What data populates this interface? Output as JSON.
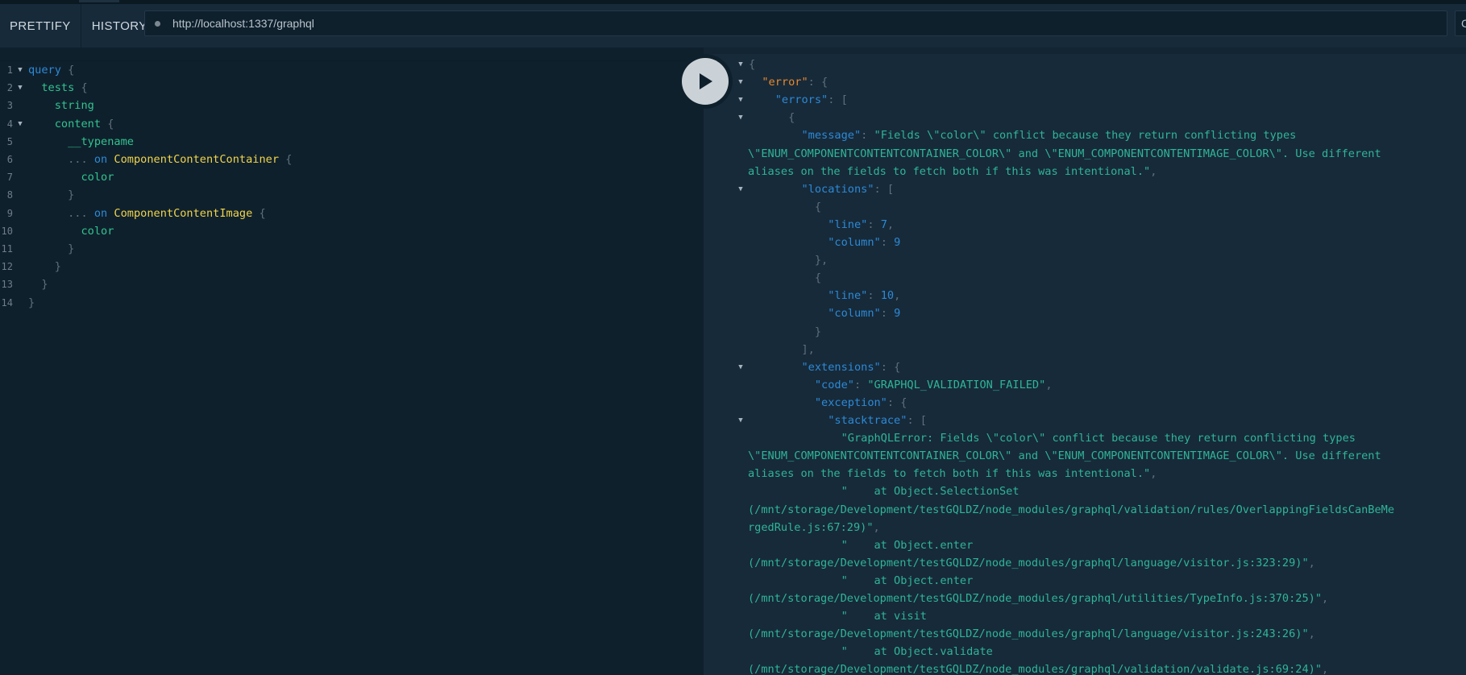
{
  "toolbar": {
    "prettify_label": "PRETTIFY",
    "history_label": "HISTORY",
    "url": "http://localhost:1337/graphql",
    "edge_label": "C"
  },
  "editor": {
    "line_numbers": [
      "1",
      "2",
      "3",
      "4",
      "5",
      "6",
      "7",
      "8",
      "9",
      "10",
      "11",
      "12",
      "13",
      "14"
    ],
    "lines": [
      [
        {
          "t": "query",
          "c": "kw"
        },
        {
          "t": " {",
          "c": "punc"
        }
      ],
      [
        {
          "t": "  tests",
          "c": "field"
        },
        {
          "t": " {",
          "c": "punc"
        }
      ],
      [
        {
          "t": "    string",
          "c": "field"
        }
      ],
      [
        {
          "t": "    content",
          "c": "field"
        },
        {
          "t": " {",
          "c": "punc"
        }
      ],
      [
        {
          "t": "      __typename",
          "c": "field"
        }
      ],
      [
        {
          "t": "      ... ",
          "c": "punc"
        },
        {
          "t": "on",
          "c": "kw"
        },
        {
          "t": " ",
          "c": "punc"
        },
        {
          "t": "ComponentContentContainer",
          "c": "type"
        },
        {
          "t": " {",
          "c": "punc"
        }
      ],
      [
        {
          "t": "        color",
          "c": "field"
        }
      ],
      [
        {
          "t": "      }",
          "c": "punc"
        }
      ],
      [
        {
          "t": "      ... ",
          "c": "punc"
        },
        {
          "t": "on",
          "c": "kw"
        },
        {
          "t": " ",
          "c": "punc"
        },
        {
          "t": "ComponentContentImage",
          "c": "type"
        },
        {
          "t": " {",
          "c": "punc"
        }
      ],
      [
        {
          "t": "        color",
          "c": "field"
        }
      ],
      [
        {
          "t": "      }",
          "c": "punc"
        }
      ],
      [
        {
          "t": "    }",
          "c": "punc"
        }
      ],
      [
        {
          "t": "  }",
          "c": "punc"
        }
      ],
      [
        {
          "t": "}",
          "c": "punc"
        }
      ]
    ]
  },
  "result": {
    "lines": [
      [
        {
          "t": "{",
          "c": "punc"
        }
      ],
      [
        {
          "t": "  ",
          "c": "punc"
        },
        {
          "t": "\"error\"",
          "c": "err"
        },
        {
          "t": ": {",
          "c": "punc"
        }
      ],
      [
        {
          "t": "    ",
          "c": "punc"
        },
        {
          "t": "\"errors\"",
          "c": "key"
        },
        {
          "t": ": [",
          "c": "punc"
        }
      ],
      [
        {
          "t": "      {",
          "c": "punc"
        }
      ],
      [
        {
          "t": "        ",
          "c": "punc"
        },
        {
          "t": "\"message\"",
          "c": "key"
        },
        {
          "t": ": ",
          "c": "punc"
        },
        {
          "t": "\"Fields \\\"color\\\" conflict because they return conflicting types",
          "c": "str"
        }
      ],
      [
        {
          "t": "\\\"ENUM_COMPONENTCONTENTCONTAINER_COLOR\\\" and \\\"ENUM_COMPONENTCONTENTIMAGE_COLOR\\\". Use different",
          "c": "str",
          "wrap": true
        }
      ],
      [
        {
          "t": "aliases on the fields to fetch both if this was intentional.\"",
          "c": "str",
          "wrap": true
        },
        {
          "t": ",",
          "c": "punc"
        }
      ],
      [
        {
          "t": "        ",
          "c": "punc"
        },
        {
          "t": "\"locations\"",
          "c": "key"
        },
        {
          "t": ": [",
          "c": "punc"
        }
      ],
      [
        {
          "t": "          {",
          "c": "punc"
        }
      ],
      [
        {
          "t": "            ",
          "c": "punc"
        },
        {
          "t": "\"line\"",
          "c": "key"
        },
        {
          "t": ": ",
          "c": "punc"
        },
        {
          "t": "7",
          "c": "num"
        },
        {
          "t": ",",
          "c": "punc"
        }
      ],
      [
        {
          "t": "            ",
          "c": "punc"
        },
        {
          "t": "\"column\"",
          "c": "key"
        },
        {
          "t": ": ",
          "c": "punc"
        },
        {
          "t": "9",
          "c": "num"
        }
      ],
      [
        {
          "t": "          },",
          "c": "punc"
        }
      ],
      [
        {
          "t": "          {",
          "c": "punc"
        }
      ],
      [
        {
          "t": "            ",
          "c": "punc"
        },
        {
          "t": "\"line\"",
          "c": "key"
        },
        {
          "t": ": ",
          "c": "punc"
        },
        {
          "t": "10",
          "c": "num"
        },
        {
          "t": ",",
          "c": "punc"
        }
      ],
      [
        {
          "t": "            ",
          "c": "punc"
        },
        {
          "t": "\"column\"",
          "c": "key"
        },
        {
          "t": ": ",
          "c": "punc"
        },
        {
          "t": "9",
          "c": "num"
        }
      ],
      [
        {
          "t": "          }",
          "c": "punc"
        }
      ],
      [
        {
          "t": "        ],",
          "c": "punc"
        }
      ],
      [
        {
          "t": "        ",
          "c": "punc"
        },
        {
          "t": "\"extensions\"",
          "c": "key"
        },
        {
          "t": ": {",
          "c": "punc"
        }
      ],
      [
        {
          "t": "          ",
          "c": "punc"
        },
        {
          "t": "\"code\"",
          "c": "key"
        },
        {
          "t": ": ",
          "c": "punc"
        },
        {
          "t": "\"GRAPHQL_VALIDATION_FAILED\"",
          "c": "str"
        },
        {
          "t": ",",
          "c": "punc"
        }
      ],
      [
        {
          "t": "          ",
          "c": "punc"
        },
        {
          "t": "\"exception\"",
          "c": "key"
        },
        {
          "t": ": {",
          "c": "punc"
        }
      ],
      [
        {
          "t": "            ",
          "c": "punc"
        },
        {
          "t": "\"stacktrace\"",
          "c": "key"
        },
        {
          "t": ": [",
          "c": "punc"
        }
      ],
      [
        {
          "t": "              ",
          "c": "punc"
        },
        {
          "t": "\"GraphQLError: Fields \\\"color\\\" conflict because they return conflicting types",
          "c": "str"
        }
      ],
      [
        {
          "t": "\\\"ENUM_COMPONENTCONTENTCONTAINER_COLOR\\\" and \\\"ENUM_COMPONENTCONTENTIMAGE_COLOR\\\". Use different",
          "c": "str",
          "wrap": true
        }
      ],
      [
        {
          "t": "aliases on the fields to fetch both if this was intentional.\"",
          "c": "str",
          "wrap": true
        },
        {
          "t": ",",
          "c": "punc"
        }
      ],
      [
        {
          "t": "              ",
          "c": "punc"
        },
        {
          "t": "\"    at Object.SelectionSet",
          "c": "str"
        }
      ],
      [
        {
          "t": "(/mnt/storage/Development/testGQLDZ/node_modules/graphql/validation/rules/OverlappingFieldsCanBeMe",
          "c": "str",
          "wrap": true
        }
      ],
      [
        {
          "t": "rgedRule.js:67:29)\"",
          "c": "str",
          "wrap": true
        },
        {
          "t": ",",
          "c": "punc"
        }
      ],
      [
        {
          "t": "              ",
          "c": "punc"
        },
        {
          "t": "\"    at Object.enter",
          "c": "str"
        }
      ],
      [
        {
          "t": "(/mnt/storage/Development/testGQLDZ/node_modules/graphql/language/visitor.js:323:29)\"",
          "c": "str",
          "wrap": true
        },
        {
          "t": ",",
          "c": "punc"
        }
      ],
      [
        {
          "t": "              ",
          "c": "punc"
        },
        {
          "t": "\"    at Object.enter",
          "c": "str"
        }
      ],
      [
        {
          "t": "(/mnt/storage/Development/testGQLDZ/node_modules/graphql/utilities/TypeInfo.js:370:25)\"",
          "c": "str",
          "wrap": true
        },
        {
          "t": ",",
          "c": "punc"
        }
      ],
      [
        {
          "t": "              ",
          "c": "punc"
        },
        {
          "t": "\"    at visit",
          "c": "str"
        }
      ],
      [
        {
          "t": "(/mnt/storage/Development/testGQLDZ/node_modules/graphql/language/visitor.js:243:26)\"",
          "c": "str",
          "wrap": true
        },
        {
          "t": ",",
          "c": "punc"
        }
      ],
      [
        {
          "t": "              ",
          "c": "punc"
        },
        {
          "t": "\"    at Object.validate",
          "c": "str"
        }
      ],
      [
        {
          "t": "(/mnt/storage/Development/testGQLDZ/node_modules/graphql/validation/validate.js:69:24)\"",
          "c": "str",
          "wrap": true
        },
        {
          "t": ",",
          "c": "punc"
        }
      ]
    ]
  },
  "colors": {
    "keyword": "#2c8ad6",
    "field": "#31c48e",
    "type": "#f0d54a",
    "punctuation": "#5e6f7b",
    "string": "#2fb596",
    "error_key": "#e8892c",
    "background": "#0f202d",
    "toolbar": "#172a3a"
  },
  "icons": {
    "run": "play-icon",
    "fold": "fold-arrow-icon",
    "url_status": "status-dot-icon"
  }
}
